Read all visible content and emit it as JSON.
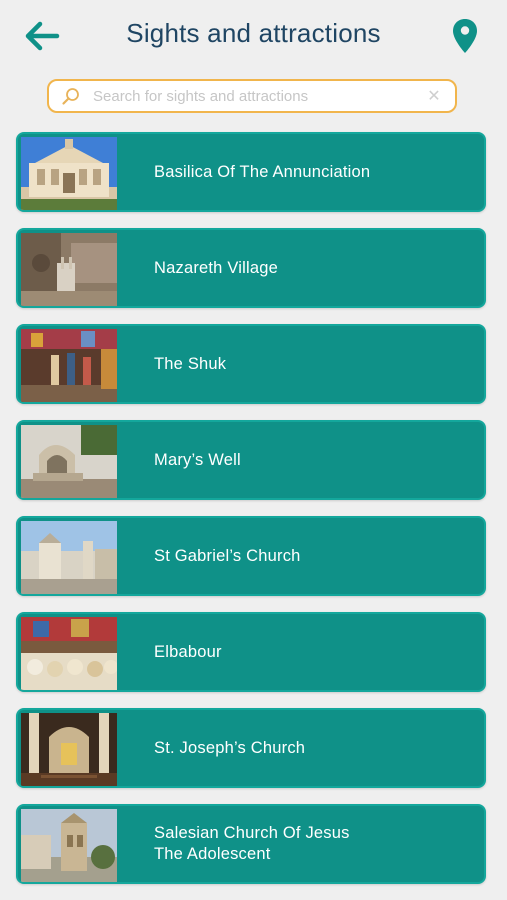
{
  "header": {
    "title": "Sights and attractions",
    "back_icon": "arrow-left-icon",
    "map_icon": "map-pin-icon"
  },
  "search": {
    "placeholder": "Search for sights and attractions",
    "value": ""
  },
  "colors": {
    "accent": "#0f9188",
    "title": "#1f4563",
    "search_border": "#f1b54c"
  },
  "items": [
    {
      "label": "Basilica Of The Annunciation"
    },
    {
      "label": "Nazareth Village"
    },
    {
      "label": "The Shuk"
    },
    {
      "label": "Mary’s Well"
    },
    {
      "label": "St Gabriel’s Church"
    },
    {
      "label": "Elbabour"
    },
    {
      "label": "St. Joseph’s Church"
    },
    {
      "label": "Salesian Church Of Jesus\nThe Adolescent"
    }
  ]
}
